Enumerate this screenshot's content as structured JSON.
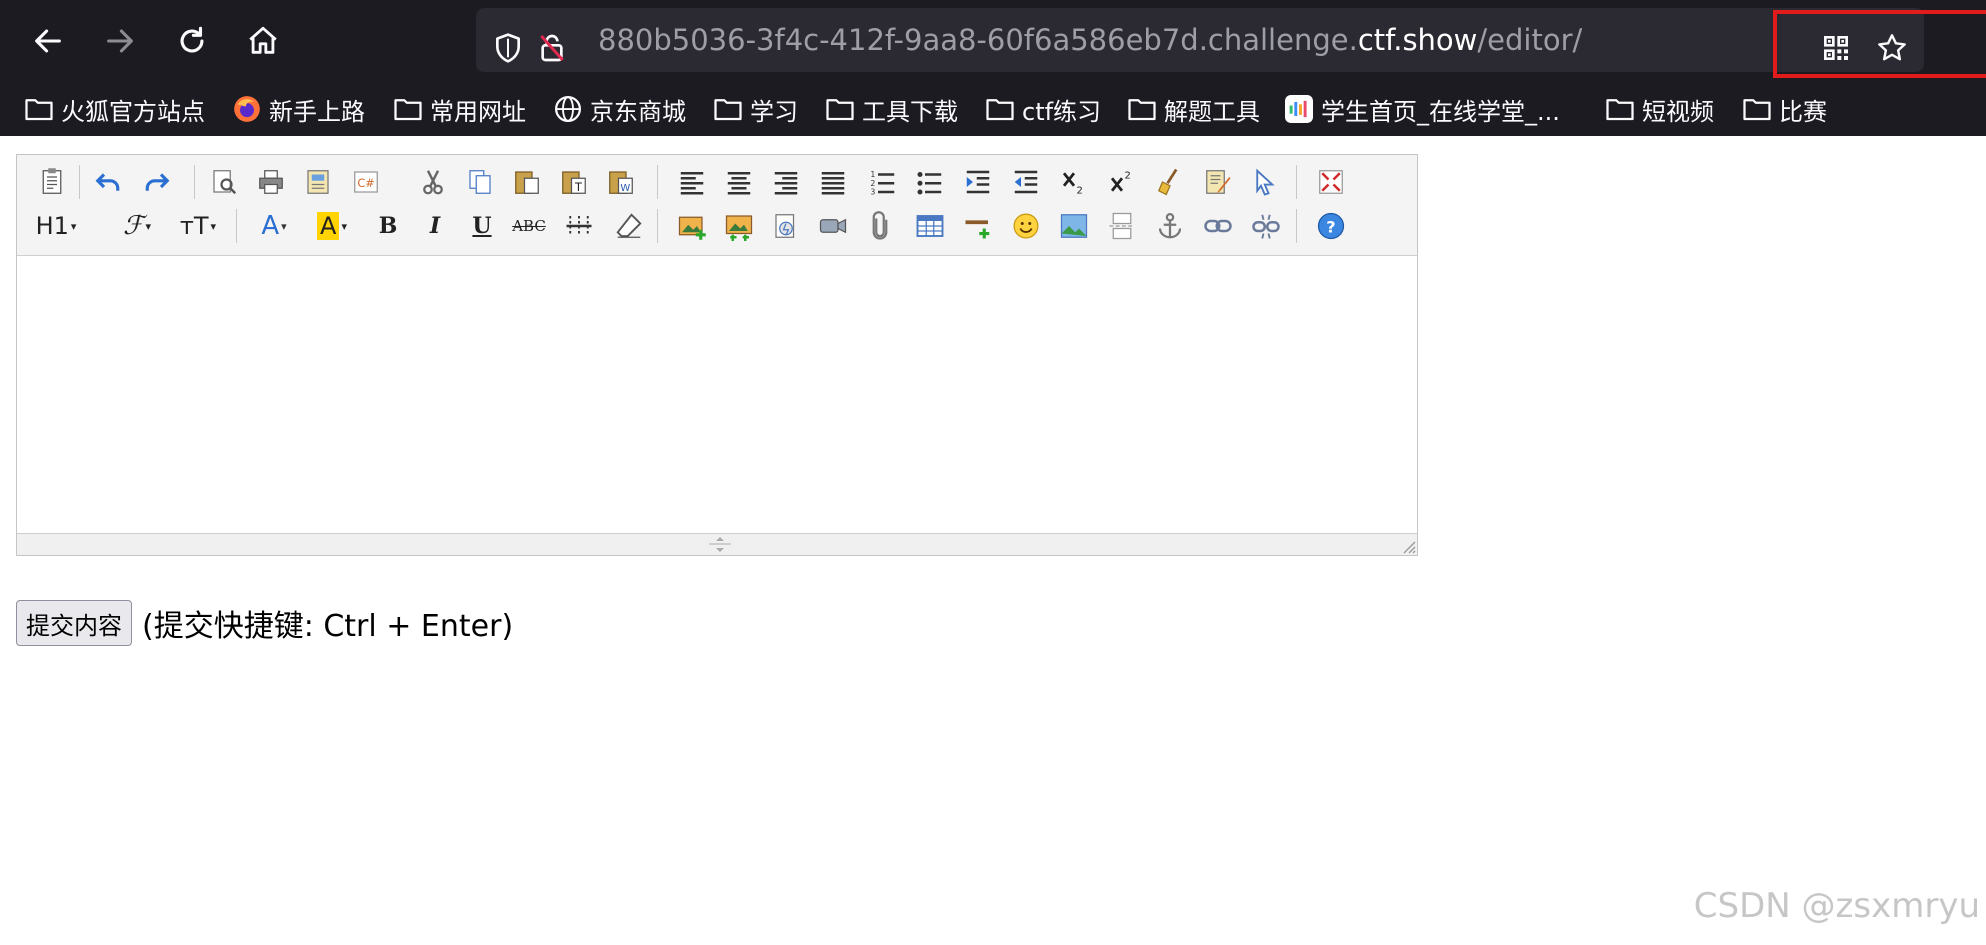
{
  "browser": {
    "url_prefix": "880b5036-3f4c-412f-9aa8-60f6a586eb7d.challenge.",
    "url_host": "ctf.show",
    "url_path": "/editor/",
    "bookmarks": [
      {
        "label": "火狐官方站点",
        "icon": "folder-icon"
      },
      {
        "label": "新手上路",
        "icon": "firefox-icon"
      },
      {
        "label": "常用网址",
        "icon": "folder-icon"
      },
      {
        "label": "京东商城",
        "icon": "globe-icon"
      },
      {
        "label": "学习",
        "icon": "folder-icon"
      },
      {
        "label": "工具下载",
        "icon": "folder-icon"
      },
      {
        "label": "ctf练习",
        "icon": "folder-icon"
      },
      {
        "label": "解题工具",
        "icon": "folder-icon"
      },
      {
        "label": "学生首页_在线学堂_...",
        "icon": "site-icon"
      },
      {
        "label": "短视频",
        "icon": "folder-icon"
      },
      {
        "label": "比赛",
        "icon": "folder-icon"
      }
    ]
  },
  "editor": {
    "heading_label": "H1",
    "font_label": "ℱ",
    "size_label": "тT",
    "fontcolor_label": "A",
    "highlight_label": "A",
    "bold_label": "B",
    "italic_label": "I",
    "underline_label": "U",
    "strike_label": "ABC"
  },
  "form": {
    "submit_label": "提交内容",
    "hint": "(提交快捷键: Ctrl + Enter)"
  },
  "watermark": "CSDN @zsxmryu",
  "colors": {
    "chrome_bg": "#1c1b22",
    "urlbar_bg": "#2b2a33",
    "highlight_box": "#e21b1b",
    "toolbar_bg": "#f4f4f4"
  }
}
